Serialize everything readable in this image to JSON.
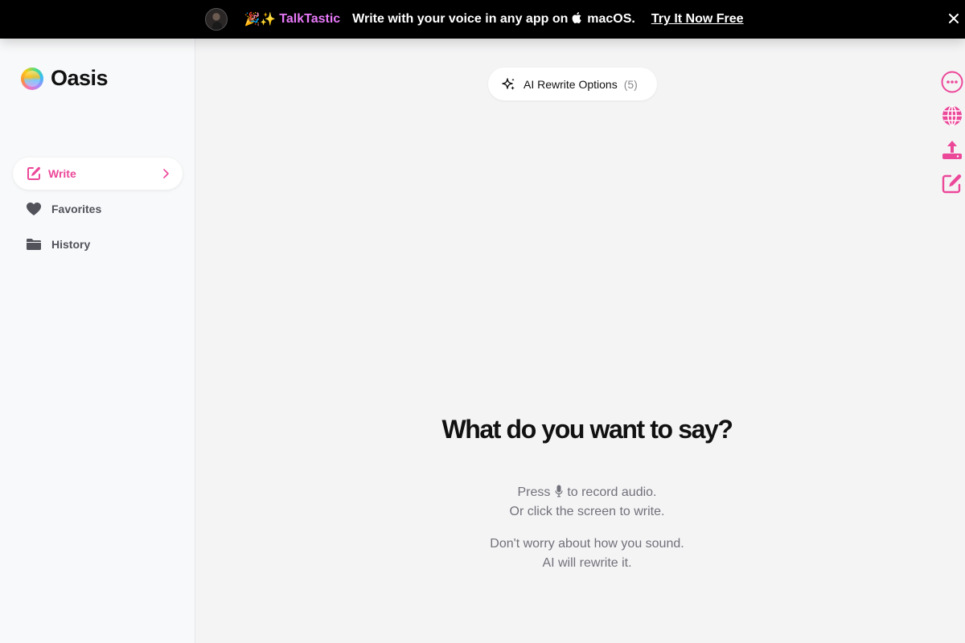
{
  "banner": {
    "emoji": "🎉✨",
    "brand": "TalkTastic",
    "message_prefix": "Write with your voice in any app on",
    "os_name": "macOS.",
    "cta": "Try It Now Free"
  },
  "sidebar": {
    "logo_text": "Oasis",
    "items": [
      {
        "label": "Write",
        "icon": "edit-icon",
        "active": true
      },
      {
        "label": "Favorites",
        "icon": "heart-icon",
        "active": false
      },
      {
        "label": "History",
        "icon": "folder-icon",
        "active": false
      }
    ]
  },
  "main": {
    "rewrite_label": "AI Rewrite Options",
    "rewrite_count": "(5)",
    "title": "What do you want to say?",
    "hint_press": "Press",
    "hint_record": "to record audio.",
    "hint_click": "Or click the screen to write.",
    "hint_worry": "Don't worry about how you sound.",
    "hint_rewrite": "AI will rewrite it."
  },
  "tools": [
    "more-icon",
    "globe-icon",
    "upload-icon",
    "edit-icon"
  ],
  "colors": {
    "accent": "#ec4899",
    "banner_bg": "#000000",
    "brand_pink": "#e879f9"
  }
}
